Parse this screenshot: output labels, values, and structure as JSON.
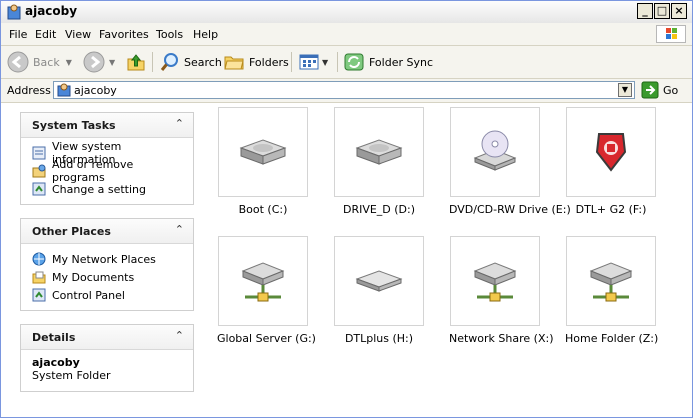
{
  "window": {
    "title": "ajacoby",
    "controls": {
      "minimize": "_",
      "maximize": "□",
      "close": "×"
    }
  },
  "menu": [
    "File",
    "Edit",
    "View",
    "Favorites",
    "Tools",
    "Help"
  ],
  "toolbar": {
    "back_label": "Back",
    "search_label": "Search",
    "folders_label": "Folders",
    "foldersync_label": "Folder Sync"
  },
  "address": {
    "label": "Address",
    "value": "ajacoby",
    "go_label": "Go"
  },
  "sidebar": {
    "system_tasks": {
      "title": "System Tasks",
      "items": [
        "View system information",
        "Add or remove programs",
        "Change a setting"
      ]
    },
    "other_places": {
      "title": "Other Places",
      "items": [
        "My Network Places",
        "My Documents",
        "Control Panel"
      ]
    },
    "details": {
      "title": "Details",
      "name": "ajacoby",
      "type": "System Folder"
    }
  },
  "drives": [
    {
      "label": "Boot (C:)",
      "icon": "hard-drive-icon"
    },
    {
      "label": "DRIVE_D (D:)",
      "icon": "hard-drive-icon"
    },
    {
      "label": "DVD/CD-RW Drive (E:)",
      "icon": "cd-drive-icon"
    },
    {
      "label": "DTL+ G2 (F:)",
      "icon": "kingston-drive-icon"
    },
    {
      "label": "Global Server (G:)",
      "icon": "network-drive-icon"
    },
    {
      "label": "DTLplus (H:)",
      "icon": "removable-drive-icon"
    },
    {
      "label": "Network Share (X:)",
      "icon": "network-drive-icon"
    },
    {
      "label": "Home Folder (Z:)",
      "icon": "network-drive-icon"
    }
  ],
  "colors": {
    "titlebar": "#f0f0f0",
    "toolbar_bg": "#f5f4ee",
    "go_green": "#3a9a2c"
  }
}
